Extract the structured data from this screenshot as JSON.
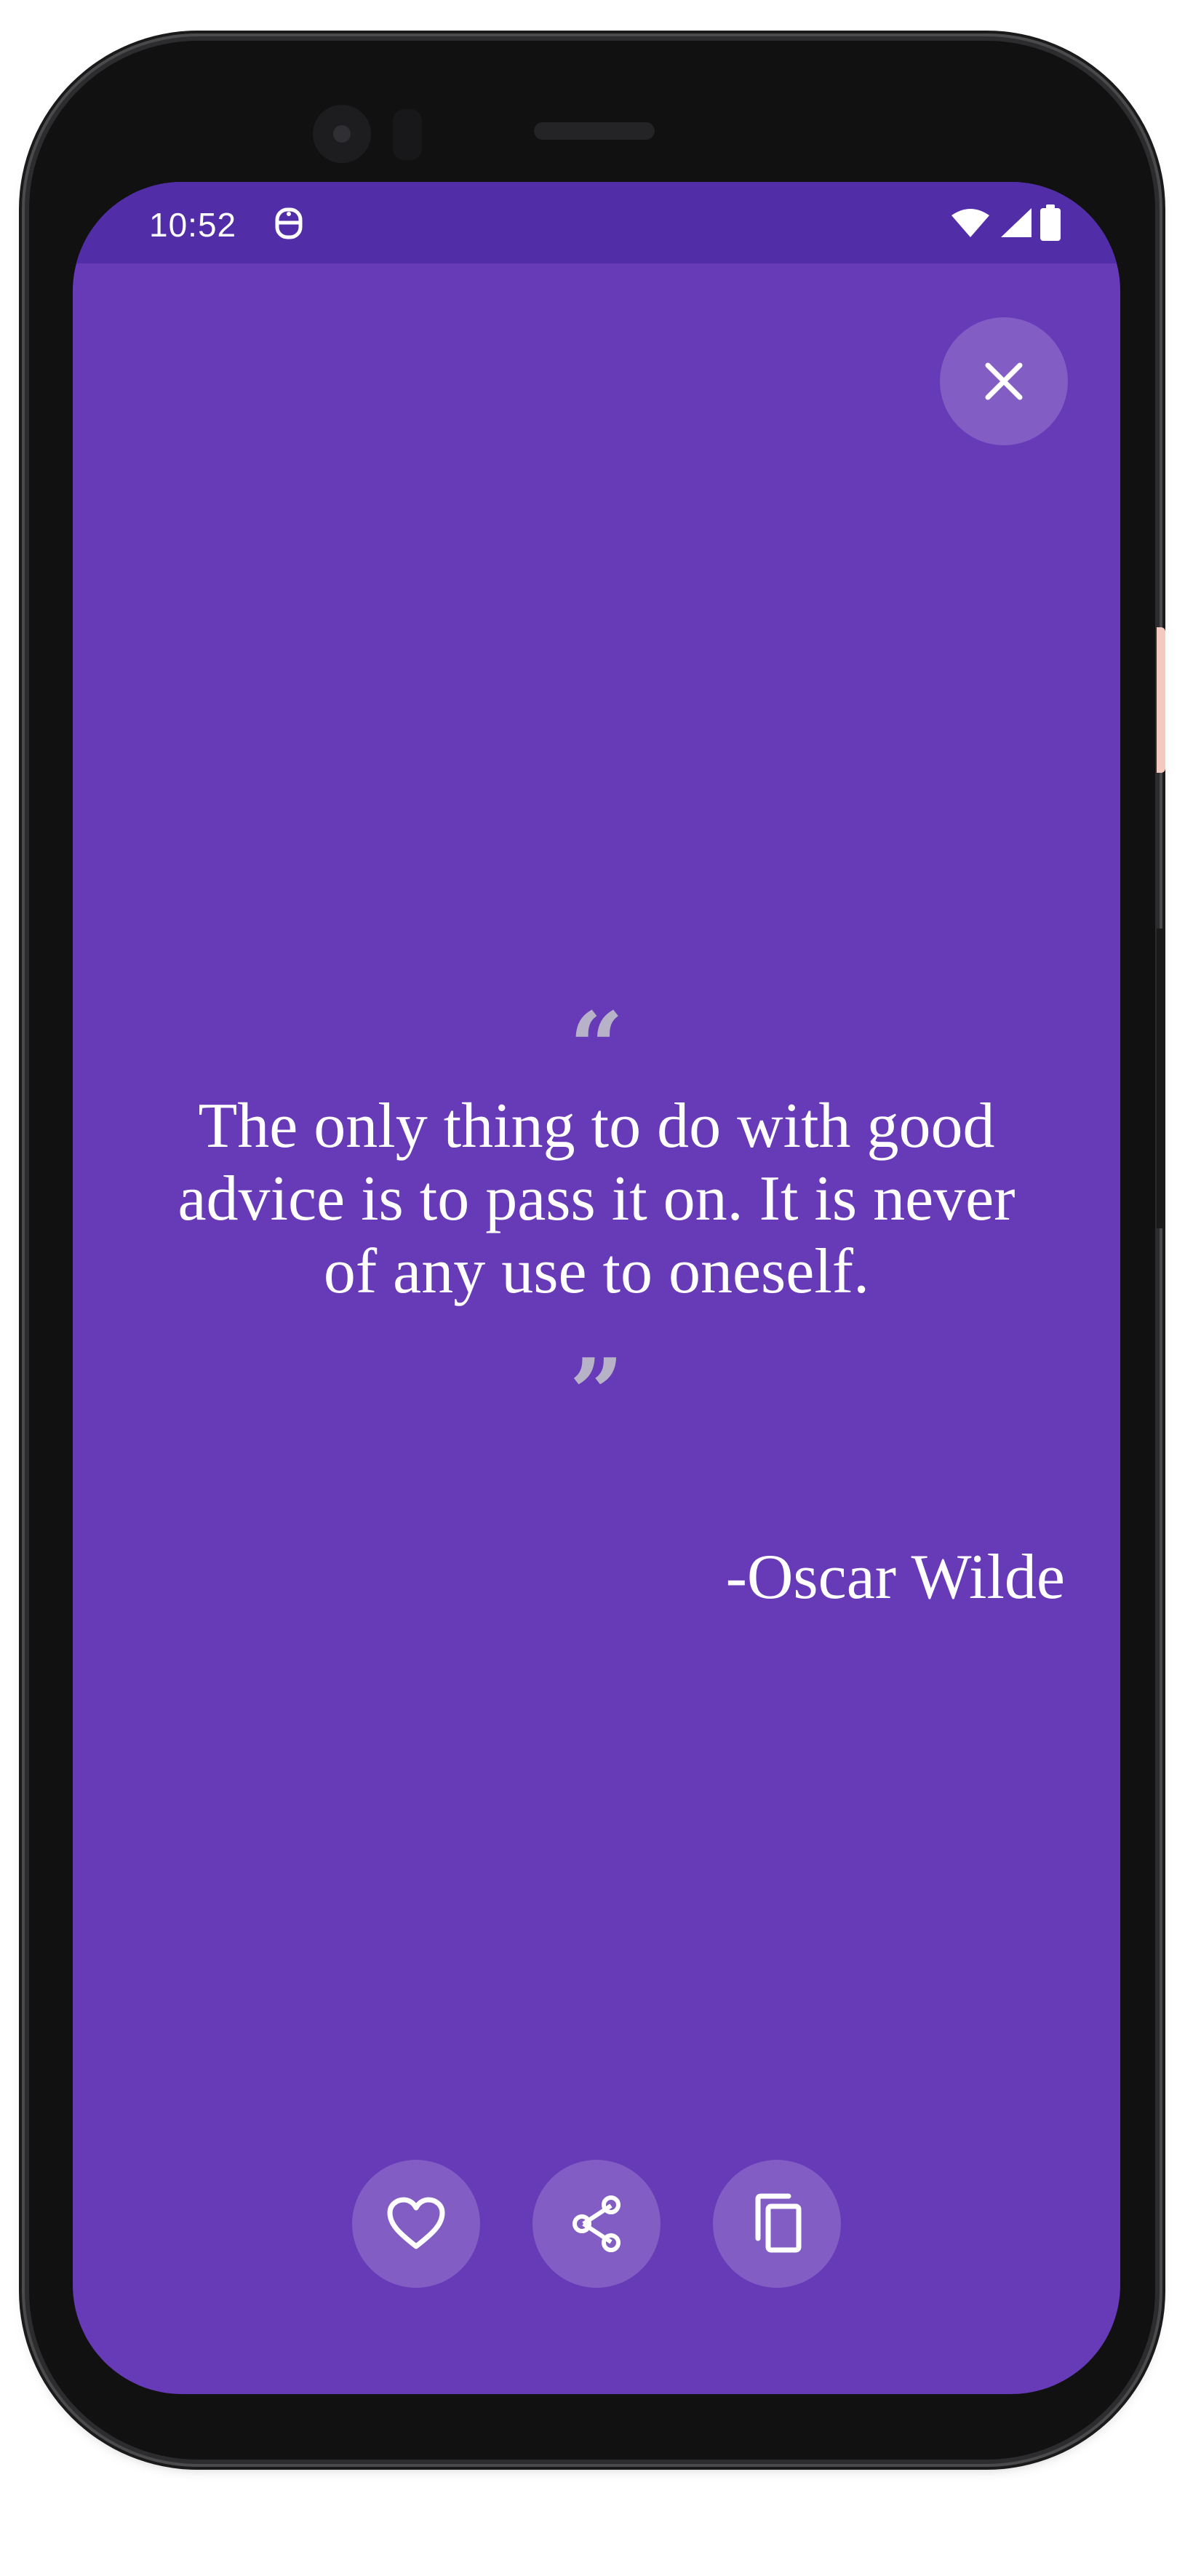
{
  "status_bar": {
    "time": "10:52",
    "app_icon": "notification-app-icon",
    "icons": [
      "wifi-icon",
      "cellular-signal-icon",
      "battery-icon"
    ]
  },
  "close_button": {
    "icon": "close-icon"
  },
  "quote": {
    "open_mark": "“",
    "text": "The only thing to do with good advice is to pass it on. It is never of any use to oneself.",
    "close_mark": "”",
    "author": "-Oscar Wilde"
  },
  "actions": [
    {
      "name": "favorite",
      "icon": "heart-icon"
    },
    {
      "name": "share",
      "icon": "share-icon"
    },
    {
      "name": "copy",
      "icon": "copy-icon"
    }
  ],
  "colors": {
    "background": "#673ab7",
    "status_bar": "#512da8",
    "text": "#ffffff",
    "quote_marks": "#b7b2c7",
    "button_fill": "rgba(255,255,255,0.18)"
  }
}
